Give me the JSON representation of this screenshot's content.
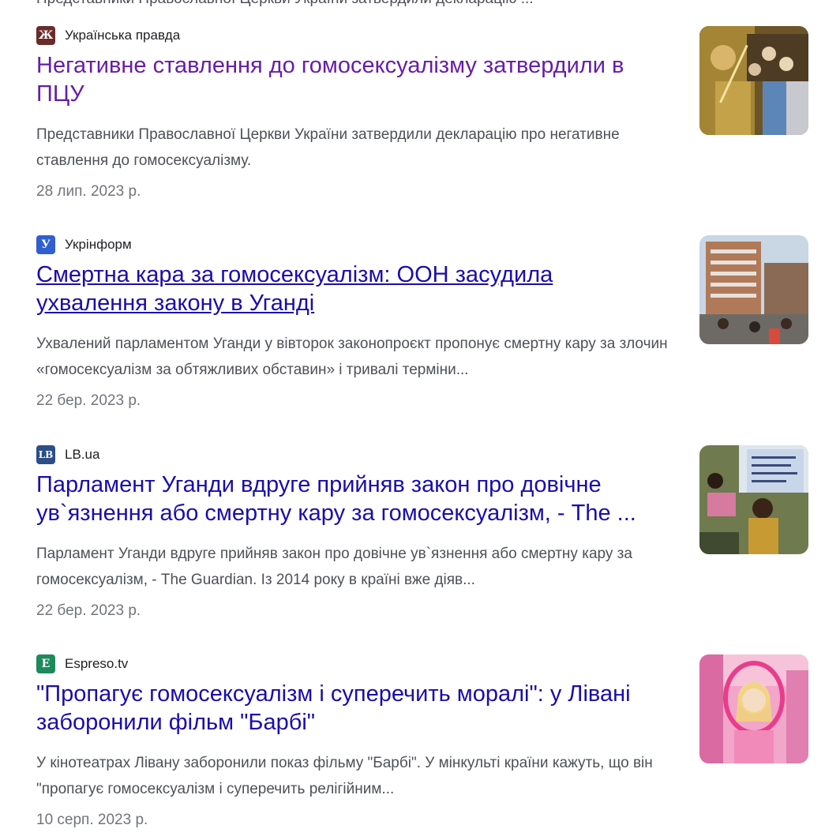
{
  "top_clipped_text": "Представники Православної Церкви України затвердили декларацію ...",
  "results": [
    {
      "source": "Українська правда",
      "favicon_glyph": "Ж",
      "favicon_color": "#6b2a2a",
      "favicon_icon": "ukrainska-pravda-icon",
      "title": "Негативне ставлення до гомосексуалізму затвердили в ПЦУ",
      "snippet": "Представники Православної Церкви України затвердили декларацію про негативне ставлення до гомосексуалізму.",
      "date": "28 лип. 2023 р.",
      "visited": true
    },
    {
      "source": "Укрінформ",
      "favicon_glyph": "У",
      "favicon_color": "#2f5fd0",
      "favicon_icon": "ukrinform-icon",
      "title": "Смертна кара за гомосексуалізм: ООН засудила ухвалення закону в Уганді",
      "snippet": "Ухвалений парламентом Уганди у вівторок законопроєкт пропонує смертну кару за злочин «гомосексуалізм за обтяжливих обставин» і тривалі терміни...",
      "date": "22 бер. 2023 р.",
      "visited": false
    },
    {
      "source": "LB.ua",
      "favicon_glyph": "LB",
      "favicon_color": "#2b4f86",
      "favicon_icon": "lb-ua-icon",
      "title": "Парламент Уганди вдруге прийняв закон про довічне ув`язнення або смертну кару за гомосексуалізм, - The ...",
      "snippet": "Парламент Уганди вдруге прийняв закон про довічне ув`язнення або смертну кару за гомосексуалізм, - The Guardian. Із 2014 року в країні вже діяв...",
      "date": "22 бер. 2023 р.",
      "visited": false
    },
    {
      "source": "Espreso.tv",
      "favicon_glyph": "E",
      "favicon_color": "#1e8a5c",
      "favicon_icon": "espreso-tv-icon",
      "title": "\"Пропагує гомосексуалізм і суперечить моралі\": у Лівані заборонили фільм \"Барбі\"",
      "snippet": "У кінотеатрах Лівану заборонили показ фільму \"Барбі\". У мінкульті країни кажуть, що він \"пропагує гомосексуалізм і суперечить релігійним...",
      "date": "10 серп. 2023 р.",
      "visited": false
    }
  ],
  "colors": {
    "link": "#1a0dab",
    "visited_link": "#681da8",
    "snippet": "#4d5156",
    "date": "#70757a"
  }
}
